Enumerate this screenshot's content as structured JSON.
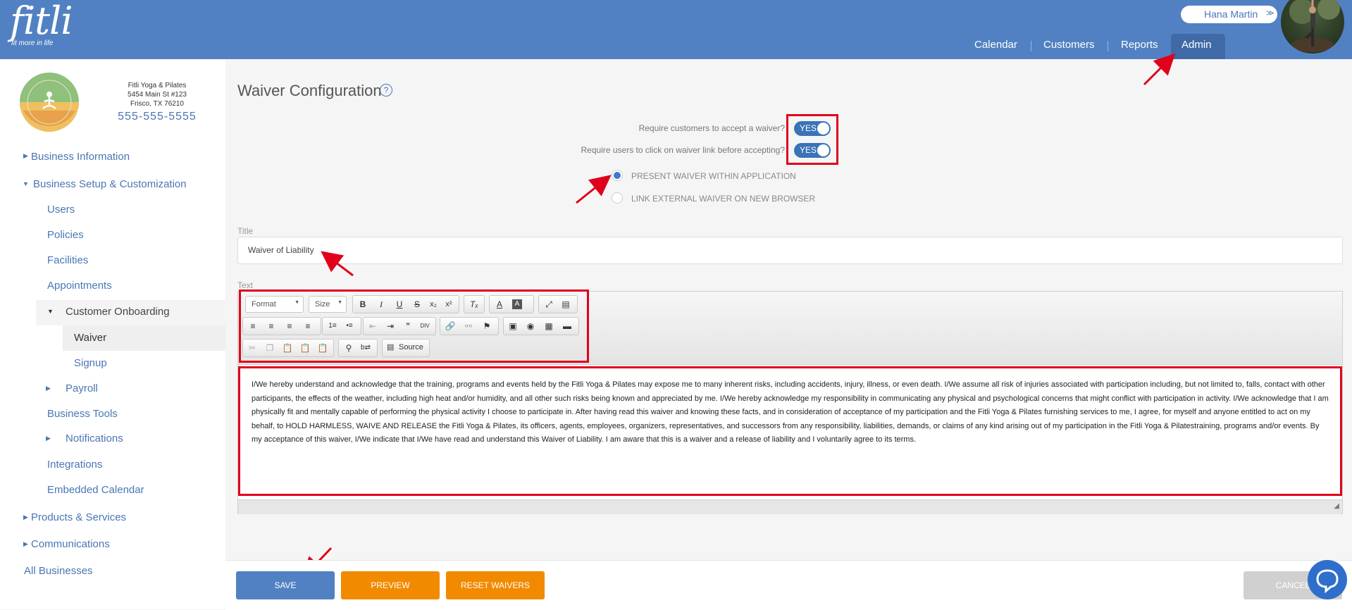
{
  "header": {
    "logo": "fitli",
    "logo_tagline": "fit more in life",
    "user_name": "Hana Martin",
    "user_chevron_icon": "chevron-double-down-icon",
    "nav": [
      {
        "label": "Calendar"
      },
      {
        "label": "Customers"
      },
      {
        "label": "Reports"
      },
      {
        "label": "Admin",
        "active": true
      }
    ]
  },
  "business": {
    "name": "Fitli Yoga & Pilates",
    "address1": "5454 Main St #123",
    "address2": "Frisco, TX 76210",
    "phone": "555-555-5555"
  },
  "sidebar": {
    "items": [
      {
        "label": "Business Information"
      },
      {
        "label": "Business Setup & Customization"
      },
      {
        "label": "Users"
      },
      {
        "label": "Policies"
      },
      {
        "label": "Facilities"
      },
      {
        "label": "Appointments"
      },
      {
        "label": "Customer Onboarding"
      },
      {
        "label": "Waiver",
        "active": true
      },
      {
        "label": "Signup"
      },
      {
        "label": "Payroll"
      },
      {
        "label": "Business Tools"
      },
      {
        "label": "Notifications"
      },
      {
        "label": "Integrations"
      },
      {
        "label": "Embedded Calendar"
      },
      {
        "label": "Products & Services"
      },
      {
        "label": "Communications"
      },
      {
        "label": "All Businesses"
      }
    ]
  },
  "page": {
    "title": "Waiver Configuration",
    "help_icon": "question-circle-icon",
    "require_accept_label": "Require customers to accept a waiver?",
    "require_accept_value": "YES",
    "require_click_label": "Require users to click on waiver link before accepting?",
    "require_click_value": "YES",
    "present_option": "PRESENT WAIVER WITHIN APPLICATION",
    "link_option": "LINK EXTERNAL WAIVER ON NEW BROWSER",
    "selected_option": "present",
    "title_label": "Title",
    "title_value": "Waiver of Liability",
    "text_label": "Text"
  },
  "editor": {
    "format_label": "Format",
    "size_label": "Size",
    "source_label": "Source",
    "waiver_text": "I/We hereby understand and acknowledge that the training, programs and events held by the Fitli Yoga & Pilates may expose me to many inherent risks, including accidents, injury, illness, or even death. I/We assume all risk of injuries associated with participation including, but not limited to, falls, contact with other participants, the effects of the weather, including high heat and/or humidity, and all other such risks being known and appreciated by me. I/We hereby acknowledge my responsibility in communicating any physical and psychological concerns that might conflict with participation in activity. I/We acknowledge that I am physically fit and mentally capable of performing the physical activity I choose to participate in. After having read this waiver and knowing these facts, and in consideration of acceptance of my participation and the Fitli Yoga & Pilates furnishing services to me, I agree, for myself and anyone entitled to act on my behalf, to HOLD HARMLESS, WAIVE AND RELEASE the Fitli Yoga & Pilates, its officers, agents, employees, organizers, representatives, and successors from any responsibility, liabilities, demands, or claims of any kind arising out of my participation in the Fitli Yoga & Pilatestraining, programs and/or events. By my acceptance of this waiver, I/We indicate that I/We have read and understand this Waiver of Liability. I am aware that this is a waiver and a release of liability and I voluntarily agree to its terms."
  },
  "buttons": {
    "save": "SAVE",
    "preview": "PREVIEW",
    "reset": "RESET WAIVERS",
    "cancel": "CANCEL"
  },
  "colors": {
    "header": "#5181c2",
    "link": "#4a76b4",
    "save": "#5181c2",
    "orange": "#f28a00",
    "annotation": "#e0001b"
  }
}
